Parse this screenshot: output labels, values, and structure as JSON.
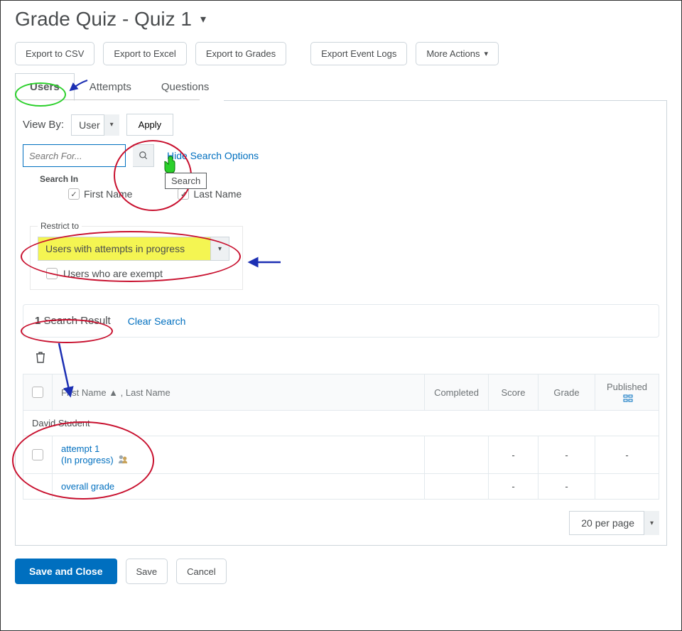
{
  "page": {
    "title": "Grade Quiz - Quiz 1"
  },
  "toolbar": {
    "export_csv": "Export to CSV",
    "export_excel": "Export to Excel",
    "export_grades": "Export to Grades",
    "export_event_logs": "Export Event Logs",
    "more_actions": "More Actions"
  },
  "tabs": {
    "users": "Users",
    "attempts": "Attempts",
    "questions": "Questions"
  },
  "filters": {
    "view_by_label": "View By:",
    "view_by_value": "User",
    "apply": "Apply",
    "search_placeholder": "Search For...",
    "hide_search_options": "Hide Search Options",
    "search_tooltip": "Search",
    "search_in_label": "Search In",
    "first_name": "First Name",
    "last_name": "Last Name",
    "restrict_legend": "Restrict to",
    "restrict_value": "Users with attempts in progress",
    "exempt_label": "Users who are exempt"
  },
  "results": {
    "count_prefix_num": "1",
    "count_suffix": " Search Result",
    "clear": "Clear Search"
  },
  "table": {
    "col_name": "First Name ▲ , Last Name",
    "col_completed": "Completed",
    "col_score": "Score",
    "col_grade": "Grade",
    "col_published": "Published",
    "student_name": "David Student",
    "attempt_label": "attempt 1",
    "attempt_status": "(In progress)",
    "overall_grade": "overall grade",
    "dash": "-"
  },
  "pager": {
    "per_page": "20 per page"
  },
  "footer": {
    "save_close": "Save and Close",
    "save": "Save",
    "cancel": "Cancel"
  }
}
